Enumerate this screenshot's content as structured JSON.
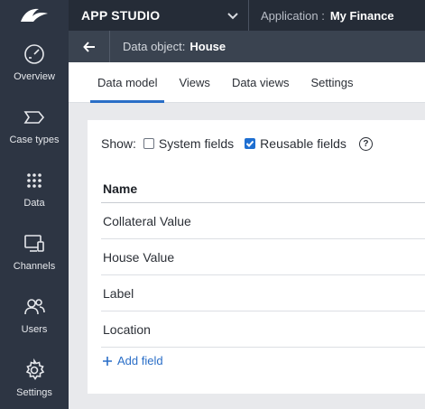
{
  "colors": {
    "sidebar": "#2d3543",
    "topbar": "#252c37",
    "subbar": "#3a4350",
    "accent": "#2a6ec7"
  },
  "sidebar": {
    "logo_icon": "pega-wing-icon",
    "items": [
      {
        "label": "Overview",
        "icon": "dashboard-gauge-icon"
      },
      {
        "label": "Case types",
        "icon": "case-type-tag-icon"
      },
      {
        "label": "Data",
        "icon": "dots-grid-icon"
      },
      {
        "label": "Channels",
        "icon": "devices-icon"
      },
      {
        "label": "Users",
        "icon": "users-icon"
      },
      {
        "label": "Settings",
        "icon": "gear-icon"
      }
    ]
  },
  "header": {
    "studio_label": "APP STUDIO",
    "application_label": "Application :",
    "application_name": "My Finance"
  },
  "subheader": {
    "object_label": "Data object:",
    "object_name": "House"
  },
  "tabs": [
    {
      "label": "Data model",
      "active": true
    },
    {
      "label": "Views",
      "active": false
    },
    {
      "label": "Data views",
      "active": false
    },
    {
      "label": "Settings",
      "active": false
    }
  ],
  "filters": {
    "show_label": "Show:",
    "system_fields": {
      "label": "System fields",
      "checked": false
    },
    "reusable_fields": {
      "label": "Reusable fields",
      "checked": true
    },
    "help_glyph": "?"
  },
  "table": {
    "column_header": "Name",
    "rows": [
      "Collateral Value",
      "House Value",
      "Label",
      "Location"
    ]
  },
  "add_field_label": "Add field"
}
